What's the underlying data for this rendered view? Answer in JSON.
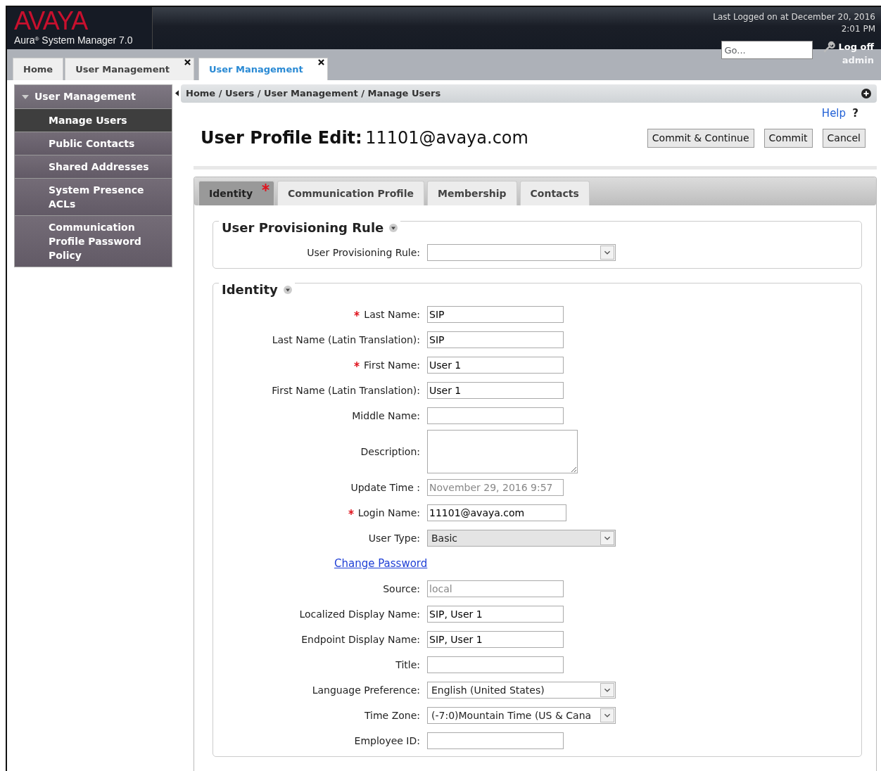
{
  "header": {
    "brand": "AVAYA",
    "product": "Aura",
    "product_sup": "®",
    "product_rest": " System Manager 7.0",
    "last_logged": "Last Logged on at December 20, 2016",
    "last_time": "2:01 PM",
    "search": {
      "placeholder": "Go..."
    },
    "logoff": "Log off",
    "user": "admin"
  },
  "tabs": [
    {
      "label": "Home",
      "selected": false,
      "closable": false
    },
    {
      "label": "User Management",
      "selected": false,
      "closable": true
    },
    {
      "label": "User Management",
      "selected": true,
      "closable": true
    }
  ],
  "sidebar": {
    "title": "User Management",
    "expanded": true,
    "items": [
      {
        "label": "Manage Users",
        "selected": true
      },
      {
        "label": "Public Contacts",
        "selected": false
      },
      {
        "label": "Shared Addresses",
        "selected": false
      },
      {
        "label": "System Presence ACLs",
        "selected": false
      },
      {
        "label": "Communication Profile Password Policy",
        "selected": false
      }
    ]
  },
  "breadcrumb": "Home / Users / User Management / Manage Users",
  "help": "Help",
  "help_mark": "?",
  "page_title": {
    "label": "User Profile Edit:",
    "value": "11101@avaya.com"
  },
  "buttons": [
    "Commit & Continue",
    "Commit",
    "Cancel"
  ],
  "form_tabs": [
    {
      "label": "Identity",
      "selected": true,
      "required": true
    },
    {
      "label": "Communication Profile",
      "selected": false,
      "required": false
    },
    {
      "label": "Membership",
      "selected": false,
      "required": false
    },
    {
      "label": "Contacts",
      "selected": false,
      "required": false
    }
  ],
  "sections": [
    {
      "title": "User Provisioning Rule",
      "expanded": true,
      "rows": [
        {
          "kind": "select",
          "label": "User Provisioning Rule:",
          "required": false,
          "value": "",
          "disabled": false
        }
      ]
    },
    {
      "title": "Identity",
      "expanded": true,
      "rows": [
        {
          "kind": "text",
          "label": "Last Name:",
          "required": true,
          "value": "SIP"
        },
        {
          "kind": "text",
          "label": "Last Name (Latin Translation):",
          "required": false,
          "value": "SIP"
        },
        {
          "kind": "text",
          "label": "First Name:",
          "required": true,
          "value": "User 1"
        },
        {
          "kind": "text",
          "label": "First Name (Latin Translation):",
          "required": false,
          "value": "User 1"
        },
        {
          "kind": "text",
          "label": "Middle Name:",
          "required": false,
          "value": ""
        },
        {
          "kind": "textarea",
          "label": "Description:",
          "required": false,
          "value": ""
        },
        {
          "kind": "readonly",
          "label": "Update Time :",
          "required": false,
          "value": "November 29, 2016 9:57"
        },
        {
          "kind": "text",
          "label": "Login Name:",
          "required": true,
          "value": "11101@avaya.com"
        },
        {
          "kind": "select",
          "label": "User Type:",
          "required": false,
          "value": "Basic",
          "disabled": true
        },
        {
          "kind": "link",
          "label": "Change Password"
        },
        {
          "kind": "readonly",
          "label": "Source:",
          "required": false,
          "value": "local"
        },
        {
          "kind": "text",
          "label": "Localized Display Name:",
          "required": false,
          "value": "SIP, User 1"
        },
        {
          "kind": "text",
          "label": "Endpoint Display Name:",
          "required": false,
          "value": "SIP, User 1"
        },
        {
          "kind": "text",
          "label": "Title:",
          "required": false,
          "value": ""
        },
        {
          "kind": "select",
          "label": "Language Preference:",
          "required": false,
          "value": "English (United States)",
          "disabled": false
        },
        {
          "kind": "select",
          "label": "Time Zone:",
          "required": false,
          "value": "(-7:0)Mountain Time (US & Canа",
          "disabled": false
        },
        {
          "kind": "text",
          "label": "Employee ID:",
          "required": false,
          "value": ""
        }
      ]
    }
  ]
}
